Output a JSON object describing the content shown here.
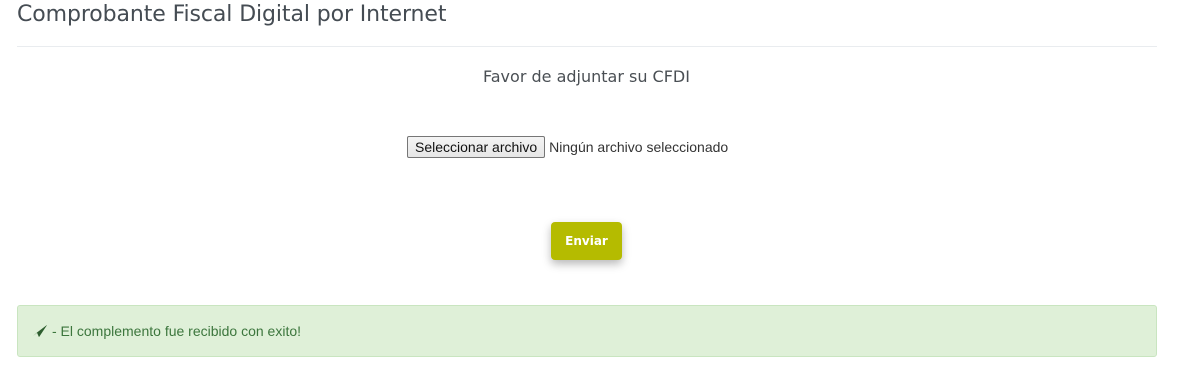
{
  "header": {
    "title": "Comprobante Fiscal Digital por Internet"
  },
  "form": {
    "prompt": "Favor de adjuntar su CFDI",
    "file_button_label": "Seleccionar archivo",
    "file_status": "Ningún archivo seleccionado",
    "submit_label": "Enviar",
    "submit_color": "#b5bb00"
  },
  "alert": {
    "icon": "paper-plane-icon",
    "message": "- El complemento fue recibido con exito!",
    "background": "#dff0d8",
    "text_color": "#3c763d"
  }
}
